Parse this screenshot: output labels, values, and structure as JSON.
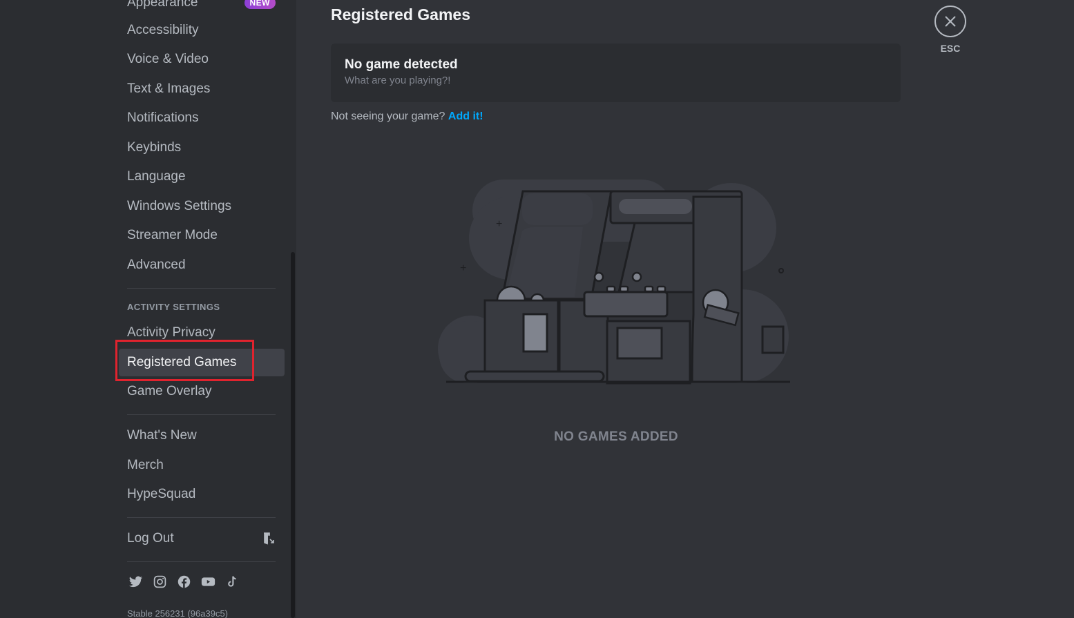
{
  "sidebar": {
    "items_top": [
      {
        "label": "Appearance",
        "badge": "NEW"
      },
      {
        "label": "Accessibility"
      },
      {
        "label": "Voice & Video"
      },
      {
        "label": "Text & Images"
      },
      {
        "label": "Notifications"
      },
      {
        "label": "Keybinds"
      },
      {
        "label": "Language"
      },
      {
        "label": "Windows Settings"
      },
      {
        "label": "Streamer Mode"
      },
      {
        "label": "Advanced"
      }
    ],
    "activity_header": "ACTIVITY SETTINGS",
    "activity_items": [
      {
        "label": "Activity Privacy"
      },
      {
        "label": "Registered Games",
        "selected": true
      },
      {
        "label": "Game Overlay"
      }
    ],
    "misc_items": [
      {
        "label": "What's New"
      },
      {
        "label": "Merch"
      },
      {
        "label": "HypeSquad"
      }
    ],
    "logout_label": "Log Out",
    "social_icons": [
      "twitter-icon",
      "instagram-icon",
      "facebook-icon",
      "youtube-icon",
      "tiktok-icon"
    ],
    "version": "Stable 256231 (96a39c5)"
  },
  "main": {
    "title": "Registered Games",
    "detect_title": "No game detected",
    "detect_subtitle": "What are you playing?!",
    "add_prompt": "Not seeing your game?",
    "add_link": "Add it!",
    "empty_label": "NO GAMES ADDED"
  },
  "close": {
    "label": "ESC"
  },
  "colors": {
    "accent_link": "#00a8fc",
    "highlight_box": "#e0232e",
    "badge_new": "#9b45d2"
  }
}
